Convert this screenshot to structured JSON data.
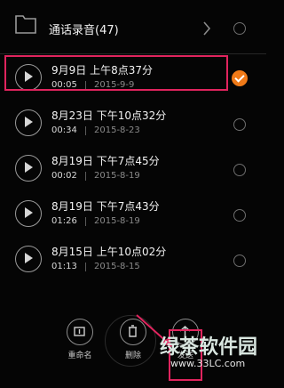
{
  "folder": {
    "title": "通话录音(47)"
  },
  "recordings": [
    {
      "title": "9月9日 上午8点37分",
      "duration": "00:05",
      "date": "2015-9-9",
      "selected": true
    },
    {
      "title": "8月23日 下午10点32分",
      "duration": "00:34",
      "date": "2015-8-23",
      "selected": false
    },
    {
      "title": "8月19日 下午7点45分",
      "duration": "00:02",
      "date": "2015-8-19",
      "selected": false
    },
    {
      "title": "8月19日 下午7点43分",
      "duration": "01:26",
      "date": "2015-8-19",
      "selected": false
    },
    {
      "title": "8月15日 上午10点02分",
      "duration": "01:13",
      "date": "2015-8-15",
      "selected": false
    }
  ],
  "actions": {
    "rename": "重命名",
    "delete": "删除",
    "share": "发送"
  },
  "watermark": {
    "logo": "绿茶软件园",
    "url": "www.33LC.com"
  },
  "colors": {
    "accent": "#f07a18",
    "highlight": "#e0245e"
  }
}
